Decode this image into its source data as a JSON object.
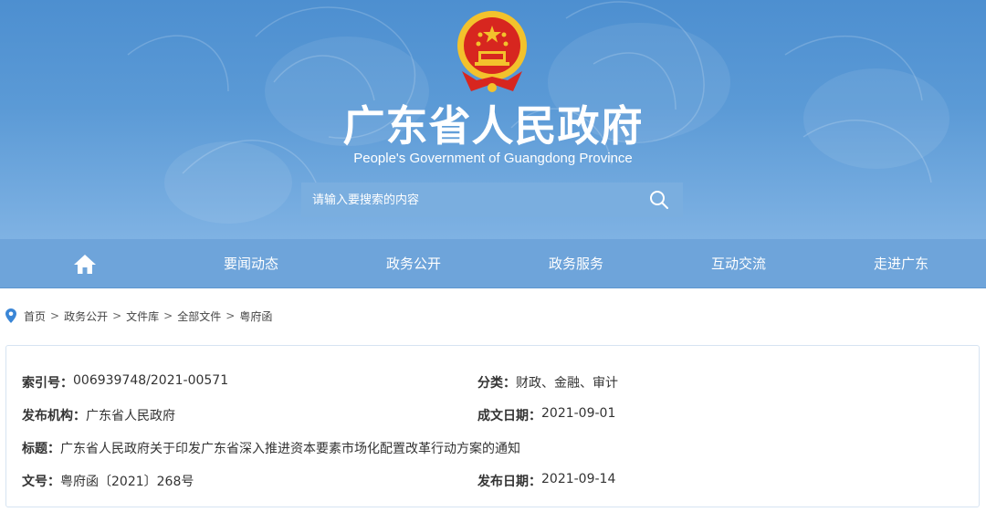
{
  "header": {
    "title": "广东省人民政府",
    "subtitle": "People's Government of Guangdong Province",
    "search_placeholder": "请输入要搜索的内容",
    "icons": [
      "national-emblem-icon",
      "search-icon"
    ]
  },
  "nav": {
    "home_icon": "home-icon",
    "items": [
      {
        "label": "要闻动态"
      },
      {
        "label": "政务公开"
      },
      {
        "label": "政务服务"
      },
      {
        "label": "互动交流"
      },
      {
        "label": "走进广东"
      }
    ]
  },
  "breadcrumb": {
    "icon": "location-pin-icon",
    "separator": ">",
    "items": [
      "首页",
      "政务公开",
      "文件库",
      "全部文件",
      "粤府函"
    ]
  },
  "document_info": {
    "index_label": "索引号：",
    "index_value": "006939748/2021-00571",
    "category_label": "分类：",
    "category_value": "财政、金融、审计",
    "publisher_label": "发布机构：",
    "publisher_value": "广东省人民政府",
    "written_date_label": "成文日期：",
    "written_date_value": "2021-09-01",
    "title_label": "标题：",
    "title_value": "广东省人民政府关于印发广东省深入推进资本要素市场化配置改革行动方案的通知",
    "doc_no_label": "文号：",
    "doc_no_value": "粤府函〔2021〕268号",
    "publish_date_label": "发布日期：",
    "publish_date_value": "2021-09-14"
  },
  "colors": {
    "banner_top": "#4d8fd0",
    "banner_bottom": "#7fb2e3",
    "nav_bar": "#6ea4da",
    "emblem_red": "#d7261f",
    "emblem_gold": "#f3c22c",
    "pin_blue": "#3a86d6"
  }
}
